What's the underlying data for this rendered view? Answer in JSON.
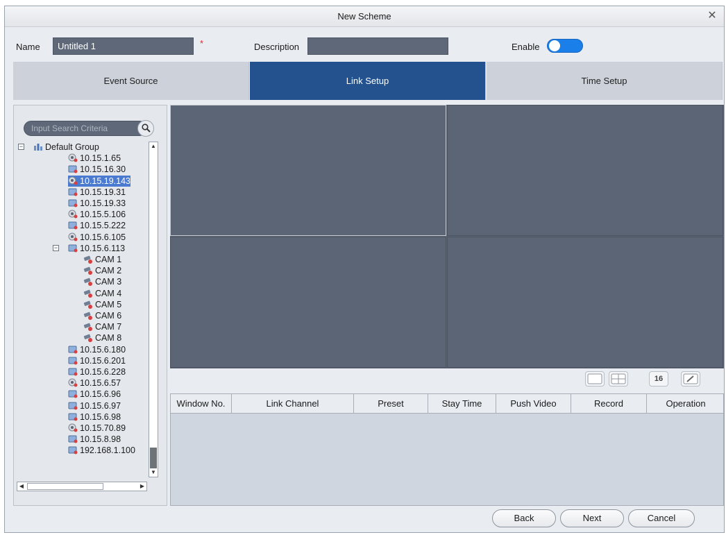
{
  "dialog": {
    "title": "New Scheme"
  },
  "form": {
    "name_label": "Name",
    "name_value": "Untitled 1",
    "required_mark": "*",
    "description_label": "Description",
    "description_value": "",
    "enable_label": "Enable",
    "enable_on": true
  },
  "tabs": [
    {
      "label": "Event Source",
      "active": false
    },
    {
      "label": "Link Setup",
      "active": true
    },
    {
      "label": "Time Setup",
      "active": false
    }
  ],
  "search": {
    "placeholder": "Input Search Criteria"
  },
  "tree": {
    "root": "Default Group",
    "devices_a": [
      "10.15.1.65",
      "10.15.16.30",
      "10.15.19.143",
      "10.15.19.31",
      "10.15.19.33",
      "10.15.5.106",
      "10.15.5.222",
      "10.15.6.105"
    ],
    "expanded_device": "10.15.6.113",
    "cameras": [
      "CAM 1",
      "CAM 2",
      "CAM 3",
      "CAM 4",
      "CAM 5",
      "CAM 6",
      "CAM 7",
      "CAM 8"
    ],
    "devices_b": [
      "10.15.6.180",
      "10.15.6.201",
      "10.15.6.228",
      "10.15.6.57",
      "10.15.6.96",
      "10.15.6.97",
      "10.15.6.98",
      "10.15.70.89",
      "10.15.8.98",
      "192.168.1.100"
    ],
    "selected": "10.15.19.143"
  },
  "layout_buttons": {
    "sixteen_label": "16"
  },
  "table": {
    "columns": [
      "Window No.",
      "Link Channel",
      "Preset",
      "Stay Time",
      "Push Video",
      "Record",
      "Operation"
    ],
    "rows": []
  },
  "footer": {
    "back": "Back",
    "next": "Next",
    "cancel": "Cancel"
  },
  "colors": {
    "accent": "#23528f",
    "toggle": "#1a7fe8",
    "field": "#5f6878",
    "video_bg": "#5c6575"
  }
}
